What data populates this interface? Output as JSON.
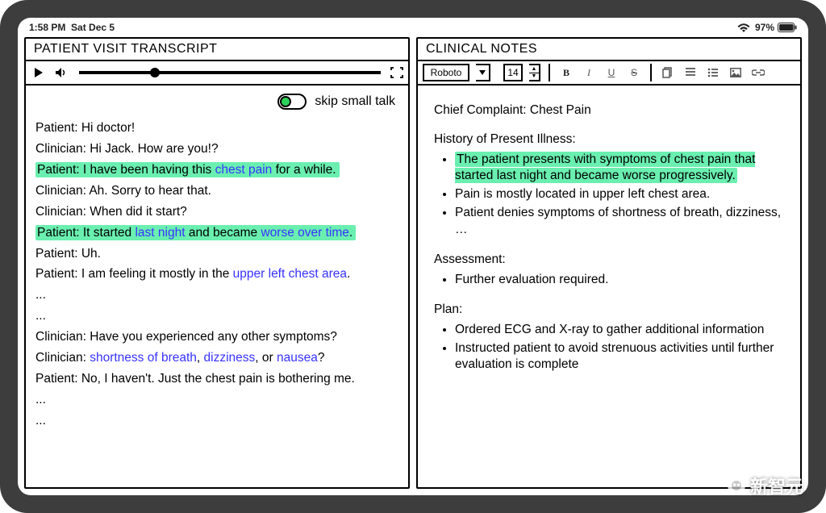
{
  "status": {
    "time": "1:58 PM",
    "date": "Sat Dec 5",
    "battery_pct": "97%"
  },
  "left": {
    "title": "PATIENT VISIT TRANSCRIPT",
    "media": {
      "progress_pct": 25
    },
    "skip_toggle_label": "skip small talk",
    "skip_toggle_on": true,
    "lines": [
      {
        "plain": "Patient: Hi doctor!"
      },
      {
        "plain": "Clinician: Hi Jack. How are you!?"
      },
      {
        "highlight": true,
        "segments": [
          {
            "t": "Patient: I have been having this "
          },
          {
            "t": "chest pain",
            "kw": true
          },
          {
            "t": " for a while."
          }
        ]
      },
      {
        "plain": "Clinician: Ah. Sorry to hear that."
      },
      {
        "plain": "Clinician: When did it start?"
      },
      {
        "highlight": true,
        "segments": [
          {
            "t": "Patient: It started "
          },
          {
            "t": "last night",
            "kw": true
          },
          {
            "t": " and became "
          },
          {
            "t": "worse over time",
            "kw": true
          },
          {
            "t": "."
          }
        ]
      },
      {
        "plain": "Patient: Uh."
      },
      {
        "segments": [
          {
            "t": "Patient: I am feeling it mostly in the "
          },
          {
            "t": "upper left chest area",
            "kw": true
          },
          {
            "t": "."
          }
        ]
      },
      {
        "plain": "..."
      },
      {
        "plain": "..."
      },
      {
        "plain": "Clinician: Have you experienced any other symptoms?"
      },
      {
        "segments": [
          {
            "t": "Clinician: "
          },
          {
            "t": "shortness of breath",
            "kw": true
          },
          {
            "t": ", "
          },
          {
            "t": "dizziness",
            "kw": true
          },
          {
            "t": ", or "
          },
          {
            "t": "nausea",
            "kw": true
          },
          {
            "t": "?"
          }
        ]
      },
      {
        "plain": "Patient: No, I haven't. Just the chest pain is bothering me."
      },
      {
        "plain": "..."
      },
      {
        "plain": "..."
      }
    ]
  },
  "right": {
    "title": "CLINICAL NOTES",
    "toolbar": {
      "font_name": "Roboto",
      "font_size": "14"
    },
    "chief_complaint_label": "Chief Complaint: Chest Pain",
    "sections": [
      {
        "heading": "History of Present Illness:",
        "items": [
          {
            "text": "The patient presents with symptoms of chest pain that started last night and became worse progressively.",
            "highlight": true
          },
          {
            "text": "Pain is mostly located in upper left chest area."
          },
          {
            "text": "Patient denies symptoms of shortness of breath, dizziness, …"
          }
        ]
      },
      {
        "heading": "Assessment:",
        "items": [
          {
            "text": "Further evaluation required."
          }
        ]
      },
      {
        "heading": "Plan:",
        "items": [
          {
            "text": "Ordered ECG and X-ray to gather additional information"
          },
          {
            "text": "Instructed patient to avoid strenuous activities until further evaluation is complete"
          }
        ]
      }
    ]
  },
  "watermark": "新智元"
}
